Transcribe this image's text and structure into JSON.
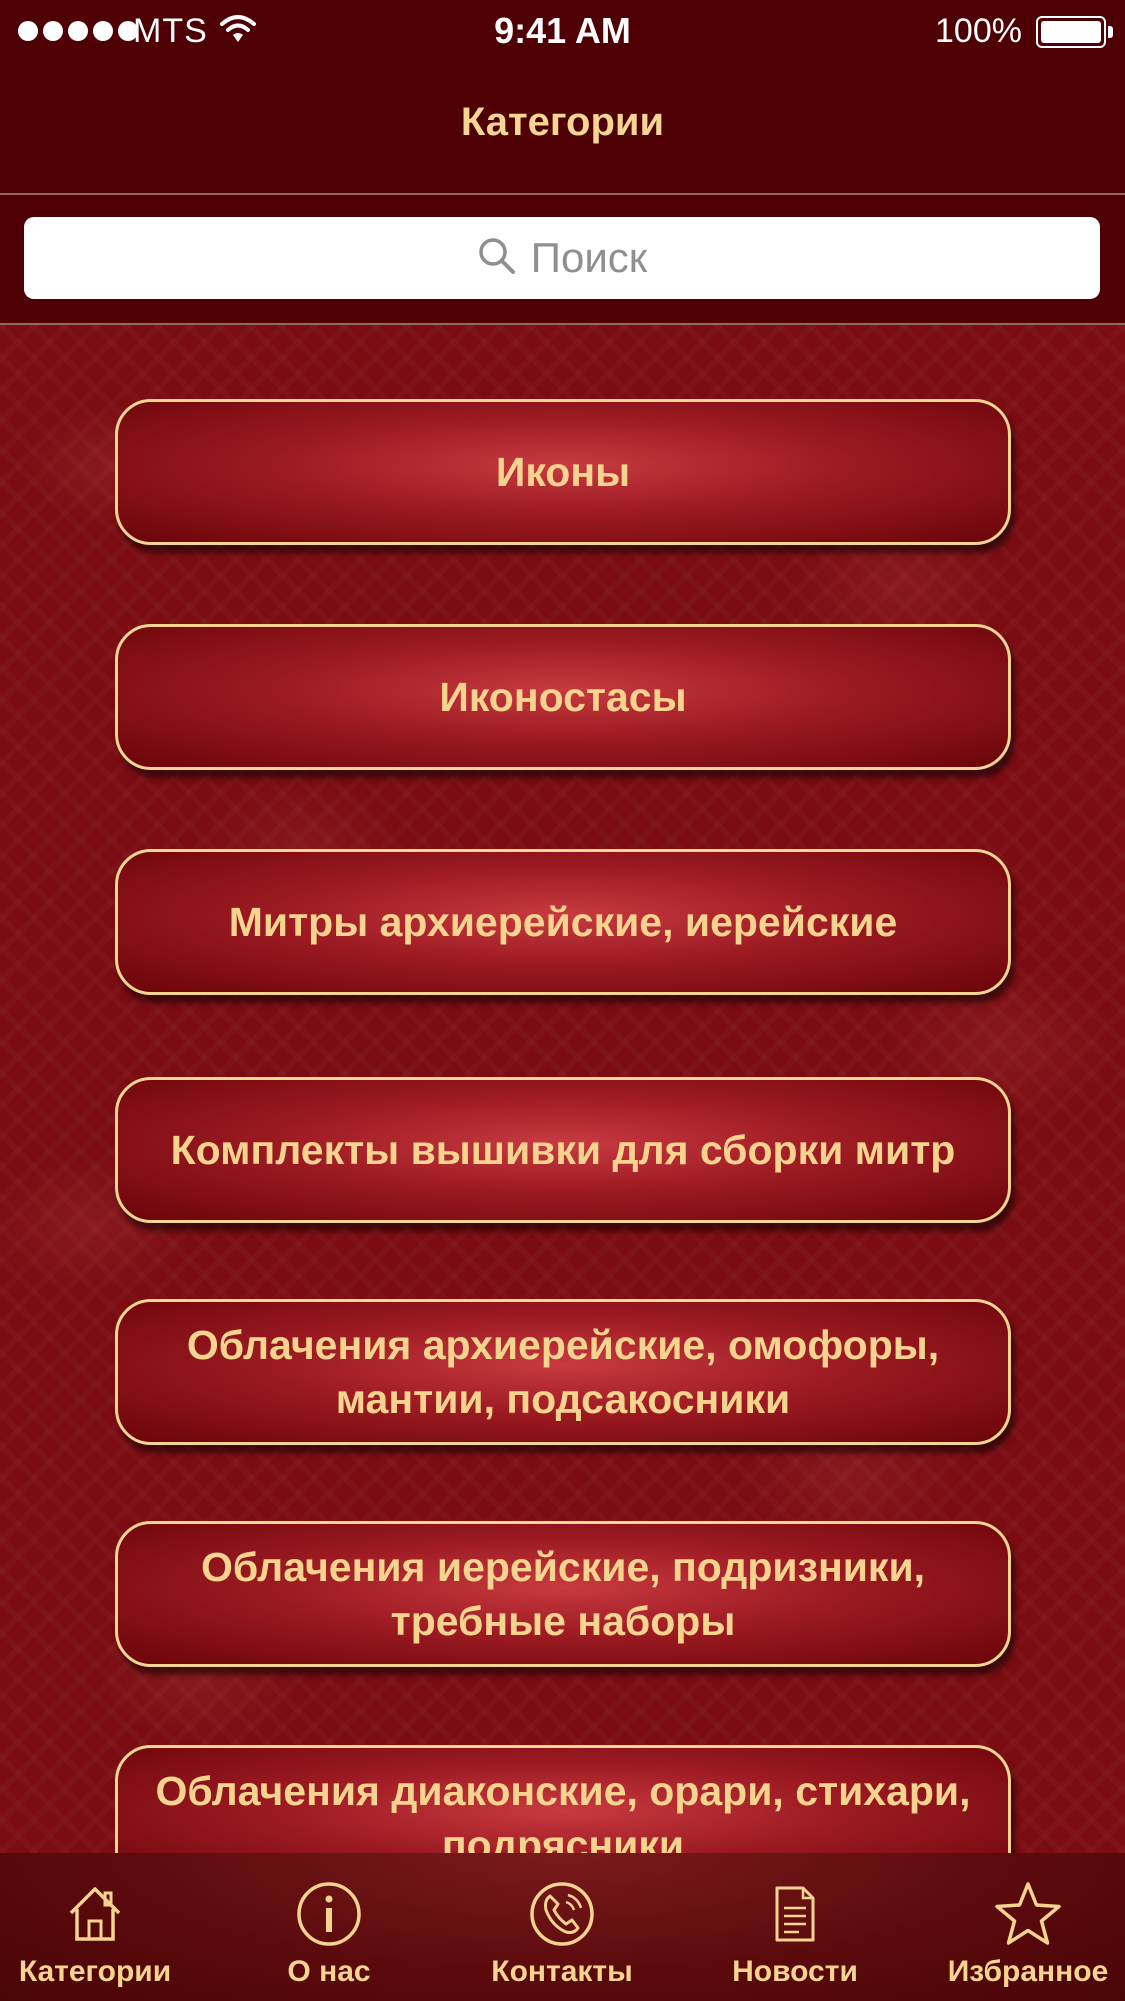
{
  "status_bar": {
    "carrier": "MTS",
    "time": "9:41 AM",
    "battery": "100%"
  },
  "nav": {
    "title": "Категории"
  },
  "search": {
    "placeholder": "Поиск"
  },
  "categories": [
    {
      "label": "Иконы"
    },
    {
      "label": "Иконостасы"
    },
    {
      "label": "Митры архиерейские, иерейские"
    },
    {
      "label": "Комплекты вышивки для сборки митр"
    },
    {
      "label": "Облачения архиерейские, омофоры, мантии, подсакосники"
    },
    {
      "label": "Облачения иерейские, подризники, требные наборы"
    },
    {
      "label": "Облачения диаконские, орари, стихари, подрясники"
    }
  ],
  "tabs": [
    {
      "label": "Категории",
      "icon": "home-icon"
    },
    {
      "label": "О нас",
      "icon": "info-icon"
    },
    {
      "label": "Контакты",
      "icon": "phone-icon"
    },
    {
      "label": "Новости",
      "icon": "document-icon"
    },
    {
      "label": "Избранное",
      "icon": "star-icon"
    }
  ],
  "colors": {
    "bar_background": "#4e0004",
    "gold_text": "#f6d490",
    "button_center": "#c83a40",
    "button_edge": "#6a0509",
    "content_background": "#7a0c12"
  }
}
